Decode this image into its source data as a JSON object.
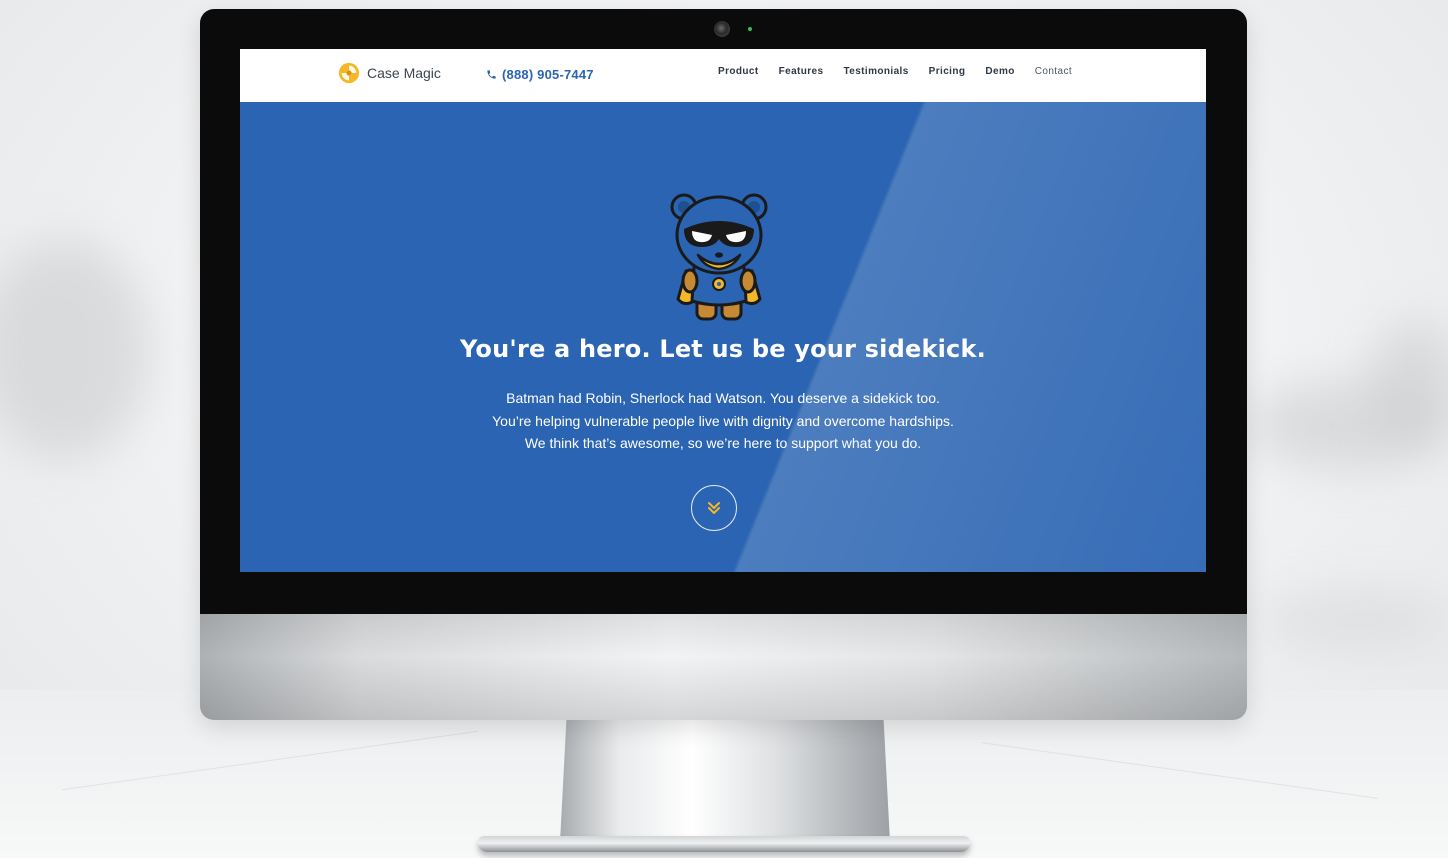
{
  "navbar": {
    "brand_name": "Case Magic",
    "phone": "(888) 905-7447",
    "items": [
      {
        "label": "Product"
      },
      {
        "label": "Features"
      },
      {
        "label": "Testimonials"
      },
      {
        "label": "Pricing"
      },
      {
        "label": "Demo"
      },
      {
        "label": "Contact"
      }
    ]
  },
  "hero": {
    "headline": "You're a hero. Let us be your sidekick.",
    "lines": [
      "Batman had Robin, Sherlock had Watson. You deserve a sidekick too.",
      "You’re helping vulnerable people live with dignity and overcome hardships.",
      "We think that’s awesome, so we’re here to support what you do."
    ],
    "scroll_icon": "double-chevron-down-icon"
  },
  "colors": {
    "brand_blue": "#2a64b2",
    "accent_yellow": "#f4b728",
    "nav_text": "#2f3844"
  }
}
